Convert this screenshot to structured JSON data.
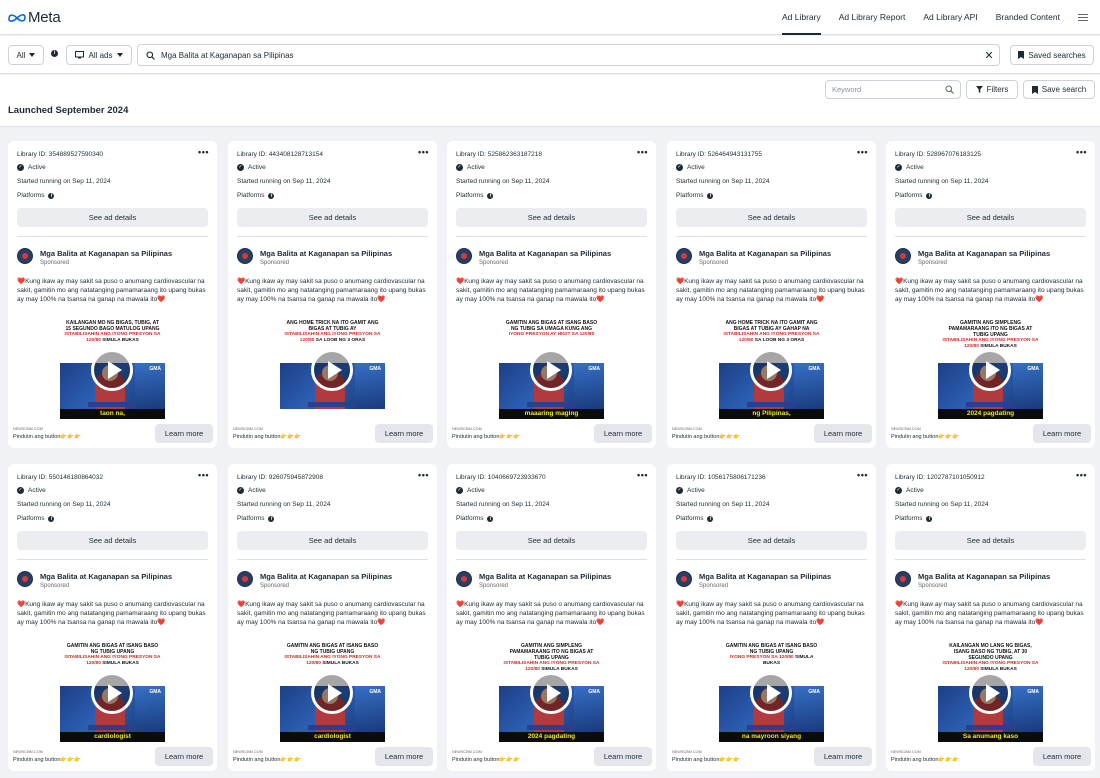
{
  "header": {
    "logo": "Meta",
    "nav": [
      "Ad Library",
      "Ad Library Report",
      "Ad Library API",
      "Branded Content"
    ]
  },
  "search": {
    "country": "All",
    "ad_category": "All ads",
    "query": "Mga Balita at Kaganapan sa Pilipinas",
    "saved_searches": "Saved searches"
  },
  "filters": {
    "keyword_placeholder": "Keyword",
    "filters_label": "Filters",
    "save_search_label": "Save search"
  },
  "results_heading": "Launched September 2024",
  "common": {
    "status": "Active",
    "started": "Started running on Sep 11, 2024",
    "platforms": "Platforms",
    "see_details": "See ad details",
    "page_name": "Mga Balita at Kaganapan sa Pilipinas",
    "sponsored": "Sponsored",
    "body": "Kung ikaw ay may sakit sa puso o anumang cardiovascular na sakit, gamitin mo ang natatanging pamamaraang ito upang bukas ay may 100% na tsansa na ganap na mawala ito",
    "domain": "NEWSCBM.COM",
    "cta_text": "Pindutin ang button",
    "learn_more": "Learn more"
  },
  "colors": {
    "accent": "#1c2b33",
    "page_bg": "#f0f2f5",
    "caption_yellow": "#f0e81c",
    "headline_red": "#d2261f"
  },
  "cards": [
    {
      "library_id": "Library ID: 354889527590340",
      "headline": "KAILANGAN MO NG BIGAS, TUBIG, AT 15 SEGUNDO BAGO MATULOG UPANG",
      "headline_red": "ISTABILISAHIN ANG IYONG PRESYON SA 120/80",
      "headline_sub": "SIMULA BUKAS",
      "caption": "taon na,"
    },
    {
      "library_id": "Library ID: 443408128713154",
      "headline": "ANG HOME TRICK NA ITO GAMIT ANG BIGAS AT TUBIG AY",
      "headline_red": "ISTABILISAHIN ANG IYONG PRESYON SA 120/80",
      "headline_sub": "SA LOOB NG 3 ORAS",
      "caption": ""
    },
    {
      "library_id": "Library ID: 525862363187218",
      "headline": "GAMITIN ANG BIGAS AT ISANG BASO NG TUBIG SA UMAGA KUNG ANG",
      "headline_red": "IYONG PRESYON AY HIGIT SA 120/80",
      "headline_sub": "",
      "caption": "maaaring maging"
    },
    {
      "library_id": "Library ID: 526464943131755",
      "headline": "ANG HOME TRICK NA ITO GAMIT ANG BIGAS AT TUBIG AY GAHAP NA",
      "headline_red": "ISTABILISAHIN ANG IYONG PRESYON SA 120/80",
      "headline_sub": "SA LOOB NG 3 ORAS",
      "caption": "ng Pilipinas,"
    },
    {
      "library_id": "Library ID: 528967076183125",
      "headline": "GAMITIN ANG SIMPLENG PAMAMARAANG ITO NG BIGAS AT TUBIG UPANG",
      "headline_red": "ISTABILISAHIN ANG IYONG PRESYON SA 120/80",
      "headline_sub": "SIMULA BUKAS",
      "caption": "2024 pagdating"
    },
    {
      "library_id": "Library ID: 550146180864032",
      "headline": "GAMITIN ANG BIGAS AT ISANG BASO NG TUBIG UPANG",
      "headline_red": "ISTABILISAHIN ANG IYONG PRESYON SA 120/80",
      "headline_sub": "SIMULA BUKAS",
      "caption": "cardiologist"
    },
    {
      "library_id": "Library ID: 926075945872908",
      "headline": "GAMITIN ANG BIGAS AT ISANG BASO NG TUBIG UPANG",
      "headline_red": "ISTABILISAHIN ANG IYONG PRESYON SA 120/80",
      "headline_sub": "SIMULA BUKAS",
      "caption": "cardiologist"
    },
    {
      "library_id": "Library ID: 1040669723933670",
      "headline": "GAMITIN ANG SIMPLENG PAMAMARAANG ITO NG BIGAS AT TUBIG UPANG",
      "headline_red": "ISTABILISAHIN ANG IYONG PRESYON SA 120/80",
      "headline_sub": "SIMULA BUKAS",
      "caption": "2024 pagdating"
    },
    {
      "library_id": "Library ID: 1056175806171236",
      "headline": "GAMITIN ANG BIGAS AT ISANG BASO NG TUBIG UPANG",
      "headline_red": "IYONG PRESYON SA 120/80",
      "headline_sub": "SIMULA BUKAS",
      "caption": "na mayroon siyang"
    },
    {
      "library_id": "Library ID: 1202787101050912",
      "headline": "KAILANGAN MO LANG NG BIGAS, ISANG BASO NG TUBIG, AT 30 SEGUNDO UPANG",
      "headline_red": "ISTABILISAHIN ANG IYONG PRESYON SA 120/80",
      "headline_sub": "SIMULA BUKAS",
      "caption": "Sa anumang kaso"
    }
  ]
}
